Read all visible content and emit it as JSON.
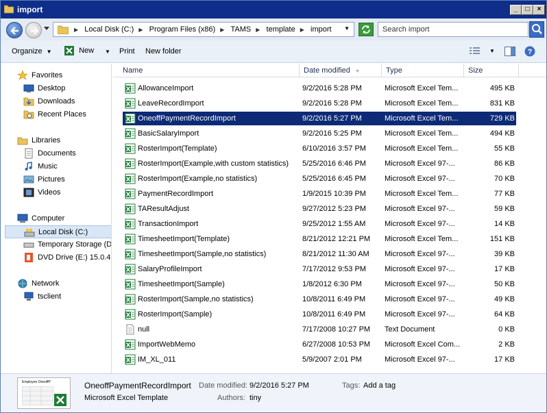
{
  "window": {
    "title": "import"
  },
  "address": {
    "crumbs": [
      "Local Disk (C:)",
      "Program Files (x86)",
      "TAMS",
      "template",
      "import"
    ]
  },
  "search": {
    "placeholder": "Search import"
  },
  "toolbar": {
    "organize": "Organize",
    "new": "New",
    "print": "Print",
    "new_folder": "New folder"
  },
  "nav": {
    "favorites": "Favorites",
    "desktop": "Desktop",
    "downloads": "Downloads",
    "recent_places": "Recent Places",
    "libraries": "Libraries",
    "documents": "Documents",
    "music": "Music",
    "pictures": "Pictures",
    "videos": "Videos",
    "computer": "Computer",
    "local_disk": "Local Disk (C:)",
    "temp_storage": "Temporary Storage (D",
    "dvd_drive": "DVD Drive (E:) 15.0.4",
    "network": "Network",
    "tsclient": "tsclient"
  },
  "columns": {
    "name": "Name",
    "date": "Date modified",
    "type": "Type",
    "size": "Size"
  },
  "files": [
    {
      "name": "AllowanceImport",
      "date": "9/2/2016 5:28 PM",
      "type": "Microsoft Excel Tem...",
      "size": "495 KB",
      "icon": "excel"
    },
    {
      "name": "LeaveRecordImport",
      "date": "9/2/2016 5:28 PM",
      "type": "Microsoft Excel Tem...",
      "size": "831 KB",
      "icon": "excel"
    },
    {
      "name": "OneoffPaymentRecordImport",
      "date": "9/2/2016 5:27 PM",
      "type": "Microsoft Excel Tem...",
      "size": "729 KB",
      "icon": "excel",
      "selected": true
    },
    {
      "name": "BasicSalaryImport",
      "date": "9/2/2016 5:25 PM",
      "type": "Microsoft Excel Tem...",
      "size": "494 KB",
      "icon": "excel"
    },
    {
      "name": "RosterImport(Template)",
      "date": "6/10/2016 3:57 PM",
      "type": "Microsoft Excel Tem...",
      "size": "55 KB",
      "icon": "excel"
    },
    {
      "name": "RosterImport(Example,with custom statistics)",
      "date": "5/25/2016 6:46 PM",
      "type": "Microsoft Excel 97-...",
      "size": "86 KB",
      "icon": "excel"
    },
    {
      "name": "RosterImport(Example,no statistics)",
      "date": "5/25/2016 6:45 PM",
      "type": "Microsoft Excel 97-...",
      "size": "70 KB",
      "icon": "excel"
    },
    {
      "name": "PaymentRecordImport",
      "date": "1/9/2015 10:39 PM",
      "type": "Microsoft Excel Tem...",
      "size": "77 KB",
      "icon": "excel"
    },
    {
      "name": "TAResultAdjust",
      "date": "9/27/2012 5:23 PM",
      "type": "Microsoft Excel 97-...",
      "size": "59 KB",
      "icon": "excel"
    },
    {
      "name": "TransactionImport",
      "date": "9/25/2012 1:55 AM",
      "type": "Microsoft Excel 97-...",
      "size": "14 KB",
      "icon": "excel"
    },
    {
      "name": "TimesheetImport(Template)",
      "date": "8/21/2012 12:21 PM",
      "type": "Microsoft Excel Tem...",
      "size": "151 KB",
      "icon": "excel"
    },
    {
      "name": "TimesheetImport(Sample,no statistics)",
      "date": "8/21/2012 11:30 AM",
      "type": "Microsoft Excel 97-...",
      "size": "39 KB",
      "icon": "excel"
    },
    {
      "name": "SalaryProfileImport",
      "date": "7/17/2012 9:53 PM",
      "type": "Microsoft Excel 97-...",
      "size": "17 KB",
      "icon": "excel"
    },
    {
      "name": "TimesheetImport(Sample)",
      "date": "1/8/2012 6:30 PM",
      "type": "Microsoft Excel 97-...",
      "size": "50 KB",
      "icon": "excel"
    },
    {
      "name": "RosterImport(Sample,no statistics)",
      "date": "10/8/2011 6:49 PM",
      "type": "Microsoft Excel 97-...",
      "size": "49 KB",
      "icon": "excel"
    },
    {
      "name": "RosterImport(Sample)",
      "date": "10/8/2011 6:49 PM",
      "type": "Microsoft Excel 97-...",
      "size": "64 KB",
      "icon": "excel"
    },
    {
      "name": "null",
      "date": "7/17/2008 10:27 PM",
      "type": "Text Document",
      "size": "0 KB",
      "icon": "text"
    },
    {
      "name": "ImportWebMemo",
      "date": "6/27/2008 10:53 PM",
      "type": "Microsoft Excel Com...",
      "size": "2 KB",
      "icon": "excel"
    },
    {
      "name": "IM_XL_011",
      "date": "5/9/2007 2:01 PM",
      "type": "Microsoft Excel 97-...",
      "size": "17 KB",
      "icon": "excel"
    }
  ],
  "details": {
    "file_name": "OneoffPaymentRecordImport",
    "file_type": "Microsoft Excel Template",
    "date_label": "Date modified:",
    "date_value": "9/2/2016 5:27 PM",
    "tags_label": "Tags:",
    "tags_value": "Add a tag",
    "authors_label": "Authors:",
    "authors_value": "tiny",
    "thumbnail_caption": "Employee OneoffP"
  },
  "colors": {
    "title_bar": "#0f2e8a",
    "selection": "#0c2a76",
    "excel_green": "#1e7b34"
  }
}
